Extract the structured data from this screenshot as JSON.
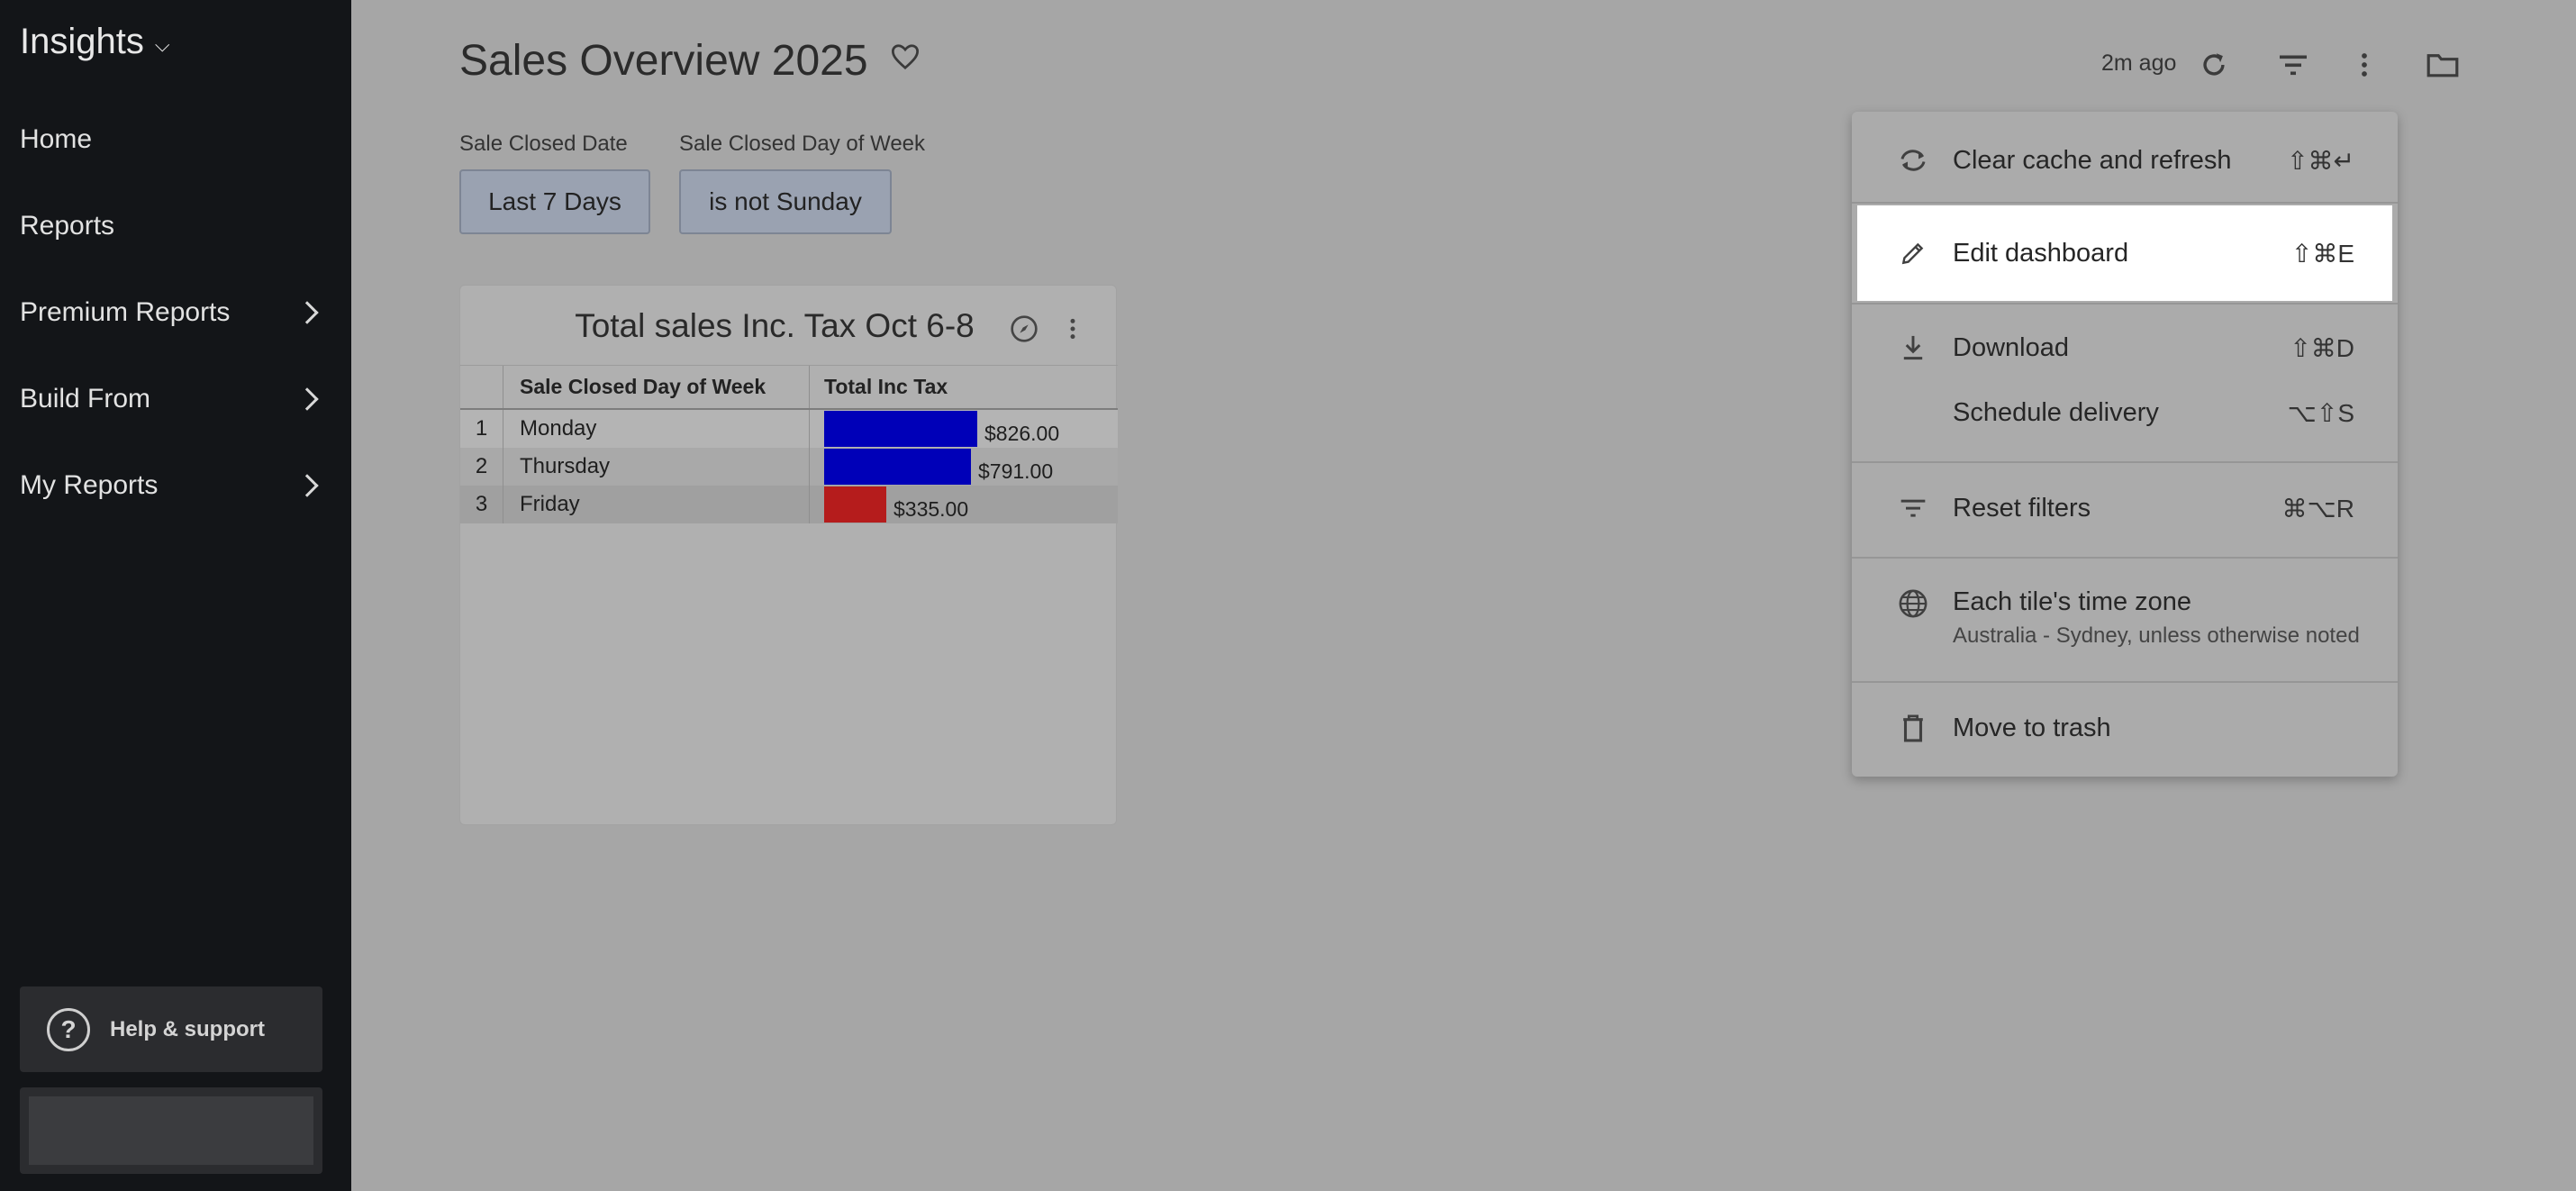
{
  "sidebar": {
    "brand": "Insights",
    "items": [
      {
        "label": "Home"
      },
      {
        "label": "Reports"
      },
      {
        "label": "Premium Reports"
      },
      {
        "label": "Build From"
      },
      {
        "label": "My Reports"
      }
    ],
    "help_label": "Help & support"
  },
  "header": {
    "title": "Sales Overview 2025",
    "updated": "2m ago"
  },
  "filters": [
    {
      "label": "Sale Closed Date",
      "value": "Last 7 Days"
    },
    {
      "label": "Sale Closed Day of Week",
      "value": "is not Sunday"
    }
  ],
  "tile": {
    "title": "Total sales Inc. Tax Oct 6-8",
    "columns": [
      "Sale Closed Day of Week",
      "Total Inc Tax"
    ],
    "rows": [
      {
        "index": "1",
        "day": "Monday",
        "total": "$826.00",
        "value": 826,
        "color": "#0000b8"
      },
      {
        "index": "2",
        "day": "Thursday",
        "total": "$791.00",
        "value": 791,
        "color": "#0000b8"
      },
      {
        "index": "3",
        "day": "Friday",
        "total": "$335.00",
        "value": 335,
        "color": "#b51c1c"
      }
    ]
  },
  "menu": {
    "items": [
      {
        "label": "Clear cache and refresh",
        "shortcut": "⇧⌘↵",
        "icon": "refresh-cache-icon"
      },
      {
        "label": "Edit dashboard",
        "shortcut": "⇧⌘E",
        "icon": "pencil-icon"
      },
      {
        "label": "Download",
        "shortcut": "⇧⌘D",
        "icon": "download-icon"
      },
      {
        "label": "Schedule delivery",
        "shortcut": "⌥⇧S"
      },
      {
        "label": "Reset filters",
        "shortcut": "⌘⌥R",
        "icon": "filter-icon"
      },
      {
        "label": "Each tile's time zone",
        "sublabel": "Australia - Sydney, unless otherwise noted",
        "icon": "globe-icon"
      },
      {
        "label": "Move to trash",
        "icon": "trash-icon"
      }
    ]
  },
  "colors": {
    "sidebar_bg": "#131518",
    "bar_high": "#0000b8",
    "bar_low": "#b51c1c"
  }
}
